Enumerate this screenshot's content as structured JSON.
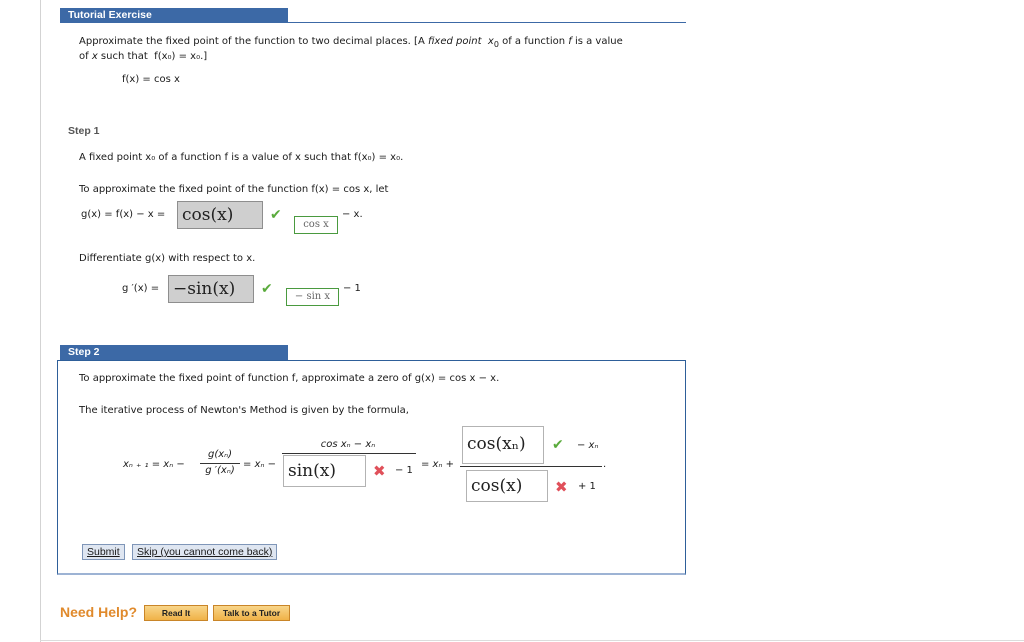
{
  "tutorial": {
    "header": "Tutorial Exercise",
    "prompt_line1_a": "Approximate the fixed point of the function to two decimal places. [A ",
    "prompt_line1_fixed": "fixed point",
    "prompt_line1_x": "x",
    "prompt_line1_sub": "0",
    "prompt_line1_b": " of a function ",
    "prompt_line1_f": "f",
    "prompt_line1_c": " is a value",
    "prompt_line2_a": "of ",
    "prompt_line2_x": "x",
    "prompt_line2_b": " such that ",
    "prompt_line2_eq": "f(x₀) = x₀.]",
    "function_display": "f(x) = cos x"
  },
  "step1": {
    "label": "Step 1",
    "definition": "A fixed point x₀ of a function f is a value of x such that f(x₀) = x₀.",
    "approx_text": "To approximate the fixed point of the function f(x) = cos x, let",
    "g_prefix": "g(x) = f(x) − x =",
    "g_answer": "cos(x)",
    "g_answer_status": "correct",
    "g_correct_answer": "cos  x",
    "g_suffix": "− x.",
    "diff_text": "Differentiate g(x) with respect to x.",
    "gprime_prefix": "g ′(x) =",
    "gprime_answer": "−sin(x)",
    "gprime_answer_status": "correct",
    "gprime_correct_answer": "− sin  x",
    "gprime_suffix": "− 1"
  },
  "step2": {
    "label": "Step 2",
    "intro": "To approximate the fixed point of function f, approximate a zero of g(x) = cos x − x.",
    "newton_text": "The iterative process of Newton's Method is given by the formula,",
    "formula_lhs": "xₙ ₊ ₁ = xₙ −",
    "frac1_num": "g(xₙ)",
    "frac1_den": "g ′(xₙ)",
    "eq2": "= xₙ −",
    "frac2_num": "cos xₙ − xₙ",
    "denominator_answer": "sin(x)",
    "denominator_answer_status": "incorrect",
    "denominator_suffix": "− 1",
    "eq3": "= xₙ +",
    "numerator_answer": "cos(xₙ)",
    "numerator_answer_status": "correct",
    "numerator_suffix": "− xₙ",
    "denominator2_answer": "cos(x)",
    "denominator2_answer_status": "incorrect",
    "denominator2_suffix": "+ 1",
    "period": ".",
    "submit_label": "Submit",
    "skip_label": "Skip (you cannot come back)"
  },
  "help": {
    "label": "Need Help?",
    "read_it": "Read It",
    "talk_to_tutor": "Talk to a Tutor"
  },
  "icons": {
    "check": "✔",
    "cross": "✖"
  },
  "colors": {
    "header_blue": "#3c69a6",
    "correct_green": "#5aab3c",
    "incorrect_red": "#e0505a",
    "help_orange": "#e08a2c"
  }
}
